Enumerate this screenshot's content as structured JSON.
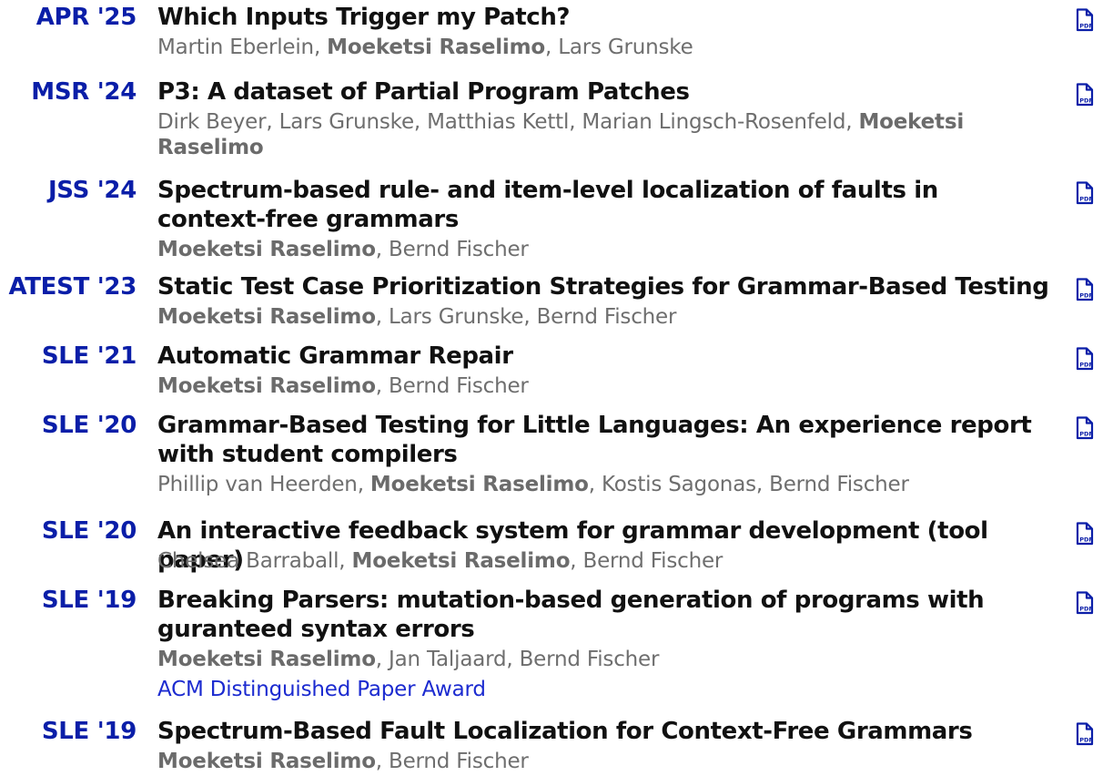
{
  "accent_color": "#0a1ea8",
  "author_color": "#6e6e6e",
  "pdf_icon": "pdf-file-icon",
  "publications": [
    {
      "venue": "APR '25",
      "title": "Which Inputs Trigger my Patch?",
      "authors": [
        "Martin Eberlein",
        "Moeketsi Raselimo",
        "Lars Grunske"
      ],
      "self_author": "Moeketsi Raselimo",
      "award": ""
    },
    {
      "venue": "MSR '24",
      "title": "P3: A dataset of Partial Program Patches",
      "authors": [
        "Dirk Beyer",
        "Lars Grunske",
        "Matthias Kettl",
        "Marian Lingsch-Rosenfeld",
        "Moeketsi Raselimo"
      ],
      "self_author": "Moeketsi Raselimo",
      "award": ""
    },
    {
      "venue": "JSS '24",
      "title": "Spectrum-based rule- and item-level localization of faults in context-free grammars",
      "authors": [
        "Moeketsi Raselimo",
        "Bernd Fischer"
      ],
      "self_author": "Moeketsi Raselimo",
      "award": ""
    },
    {
      "venue": "ATEST '23",
      "title": "Static Test Case Prioritization Strategies for Grammar-Based Testing",
      "authors": [
        "Moeketsi Raselimo",
        "Lars Grunske",
        "Bernd Fischer"
      ],
      "self_author": "Moeketsi Raselimo",
      "award": ""
    },
    {
      "venue": "SLE '21",
      "title": "Automatic Grammar Repair",
      "authors": [
        "Moeketsi Raselimo",
        "Bernd Fischer"
      ],
      "self_author": "Moeketsi Raselimo",
      "award": ""
    },
    {
      "venue": "SLE '20",
      "title": "Grammar-Based Testing for Little Languages: An experience report with student compilers",
      "authors": [
        "Phillip van Heerden",
        "Moeketsi Raselimo",
        "Kostis Sagonas",
        "Bernd Fischer"
      ],
      "self_author": "Moeketsi Raselimo",
      "award": ""
    },
    {
      "venue": "SLE '20",
      "title": "An interactive feedback system for grammar development (tool paper)",
      "authors": [
        "Chelsea Barraball",
        "Moeketsi Raselimo",
        "Bernd Fischer"
      ],
      "self_author": "Moeketsi Raselimo",
      "award": ""
    },
    {
      "venue": "SLE '19",
      "title": "Breaking Parsers: mutation-based generation of programs with guranteed syntax errors",
      "authors": [
        "Moeketsi Raselimo",
        "Jan Taljaard",
        "Bernd Fischer"
      ],
      "self_author": "Moeketsi Raselimo",
      "award": "ACM Distinguished Paper Award"
    },
    {
      "venue": "SLE '19",
      "title": "Spectrum-Based Fault Localization for Context-Free Grammars",
      "authors": [
        "Moeketsi Raselimo",
        "Bernd Fischer"
      ],
      "self_author": "Moeketsi Raselimo",
      "award": ""
    }
  ]
}
